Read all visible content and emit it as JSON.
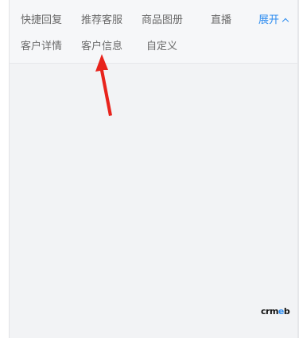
{
  "tabs": {
    "row1": [
      {
        "label": "快捷回复"
      },
      {
        "label": "推荐客服"
      },
      {
        "label": "商品图册"
      },
      {
        "label": "直播"
      }
    ],
    "row2": [
      {
        "label": "客户详情"
      },
      {
        "label": "客户信息"
      },
      {
        "label": "自定义"
      }
    ],
    "expand_label": "展开"
  },
  "watermark": {
    "text_main": "crm",
    "text_accent": "e",
    "text_tail": "b"
  },
  "colors": {
    "accent": "#2d8cf0",
    "arrow": "#e8231c",
    "tab_text": "#6b6b6b"
  },
  "icons": {
    "expand": "chevron-up-icon",
    "pointer": "red-arrow-annotation"
  }
}
